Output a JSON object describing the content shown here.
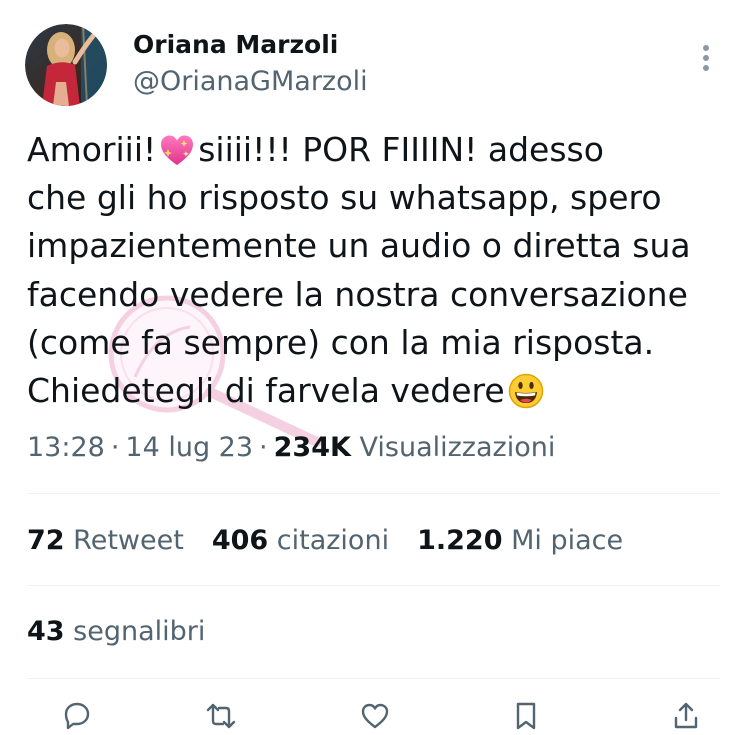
{
  "author": {
    "name": "Oriana Marzoli",
    "handle": "@OrianaGMarzoli",
    "avatar_icon": "profile-photo"
  },
  "more_icon": "more-vertical-icon",
  "tweet": {
    "line_1a": "Amoriii!",
    "emoji_1": "sparkling-heart-emoji",
    "line_1b": "siiii!!! POR FIIIIN! adesso",
    "line_2": "che gli ho risposto su whatsapp, spero",
    "line_3": "impazientemente un audio o diretta sua",
    "line_4": "facendo vedere la nostra conversazione",
    "line_5": "(come fa sempre) con la mia risposta.",
    "line_6": "Chiedetegli di farvela vedere",
    "emoji_2": "grinning-face-emoji"
  },
  "meta": {
    "time": "13:28",
    "separator": "·",
    "date": "14 lug 23",
    "views_count": "234K",
    "views_label": "Visualizzazioni"
  },
  "stats": {
    "retweets": {
      "count": "72",
      "label": "Retweet"
    },
    "quotes": {
      "count": "406",
      "label": "citazioni"
    },
    "likes": {
      "count": "1.220",
      "label": "Mi piace"
    },
    "bookmarks": {
      "count": "43",
      "label": "segnalibri"
    }
  },
  "action_icons": [
    "reply-icon",
    "retweet-icon",
    "like-icon",
    "bookmark-icon",
    "share-icon"
  ],
  "colors": {
    "text": "#0f1419",
    "secondary": "#536471",
    "divider": "#eff3f4",
    "background": "#ffffff"
  }
}
